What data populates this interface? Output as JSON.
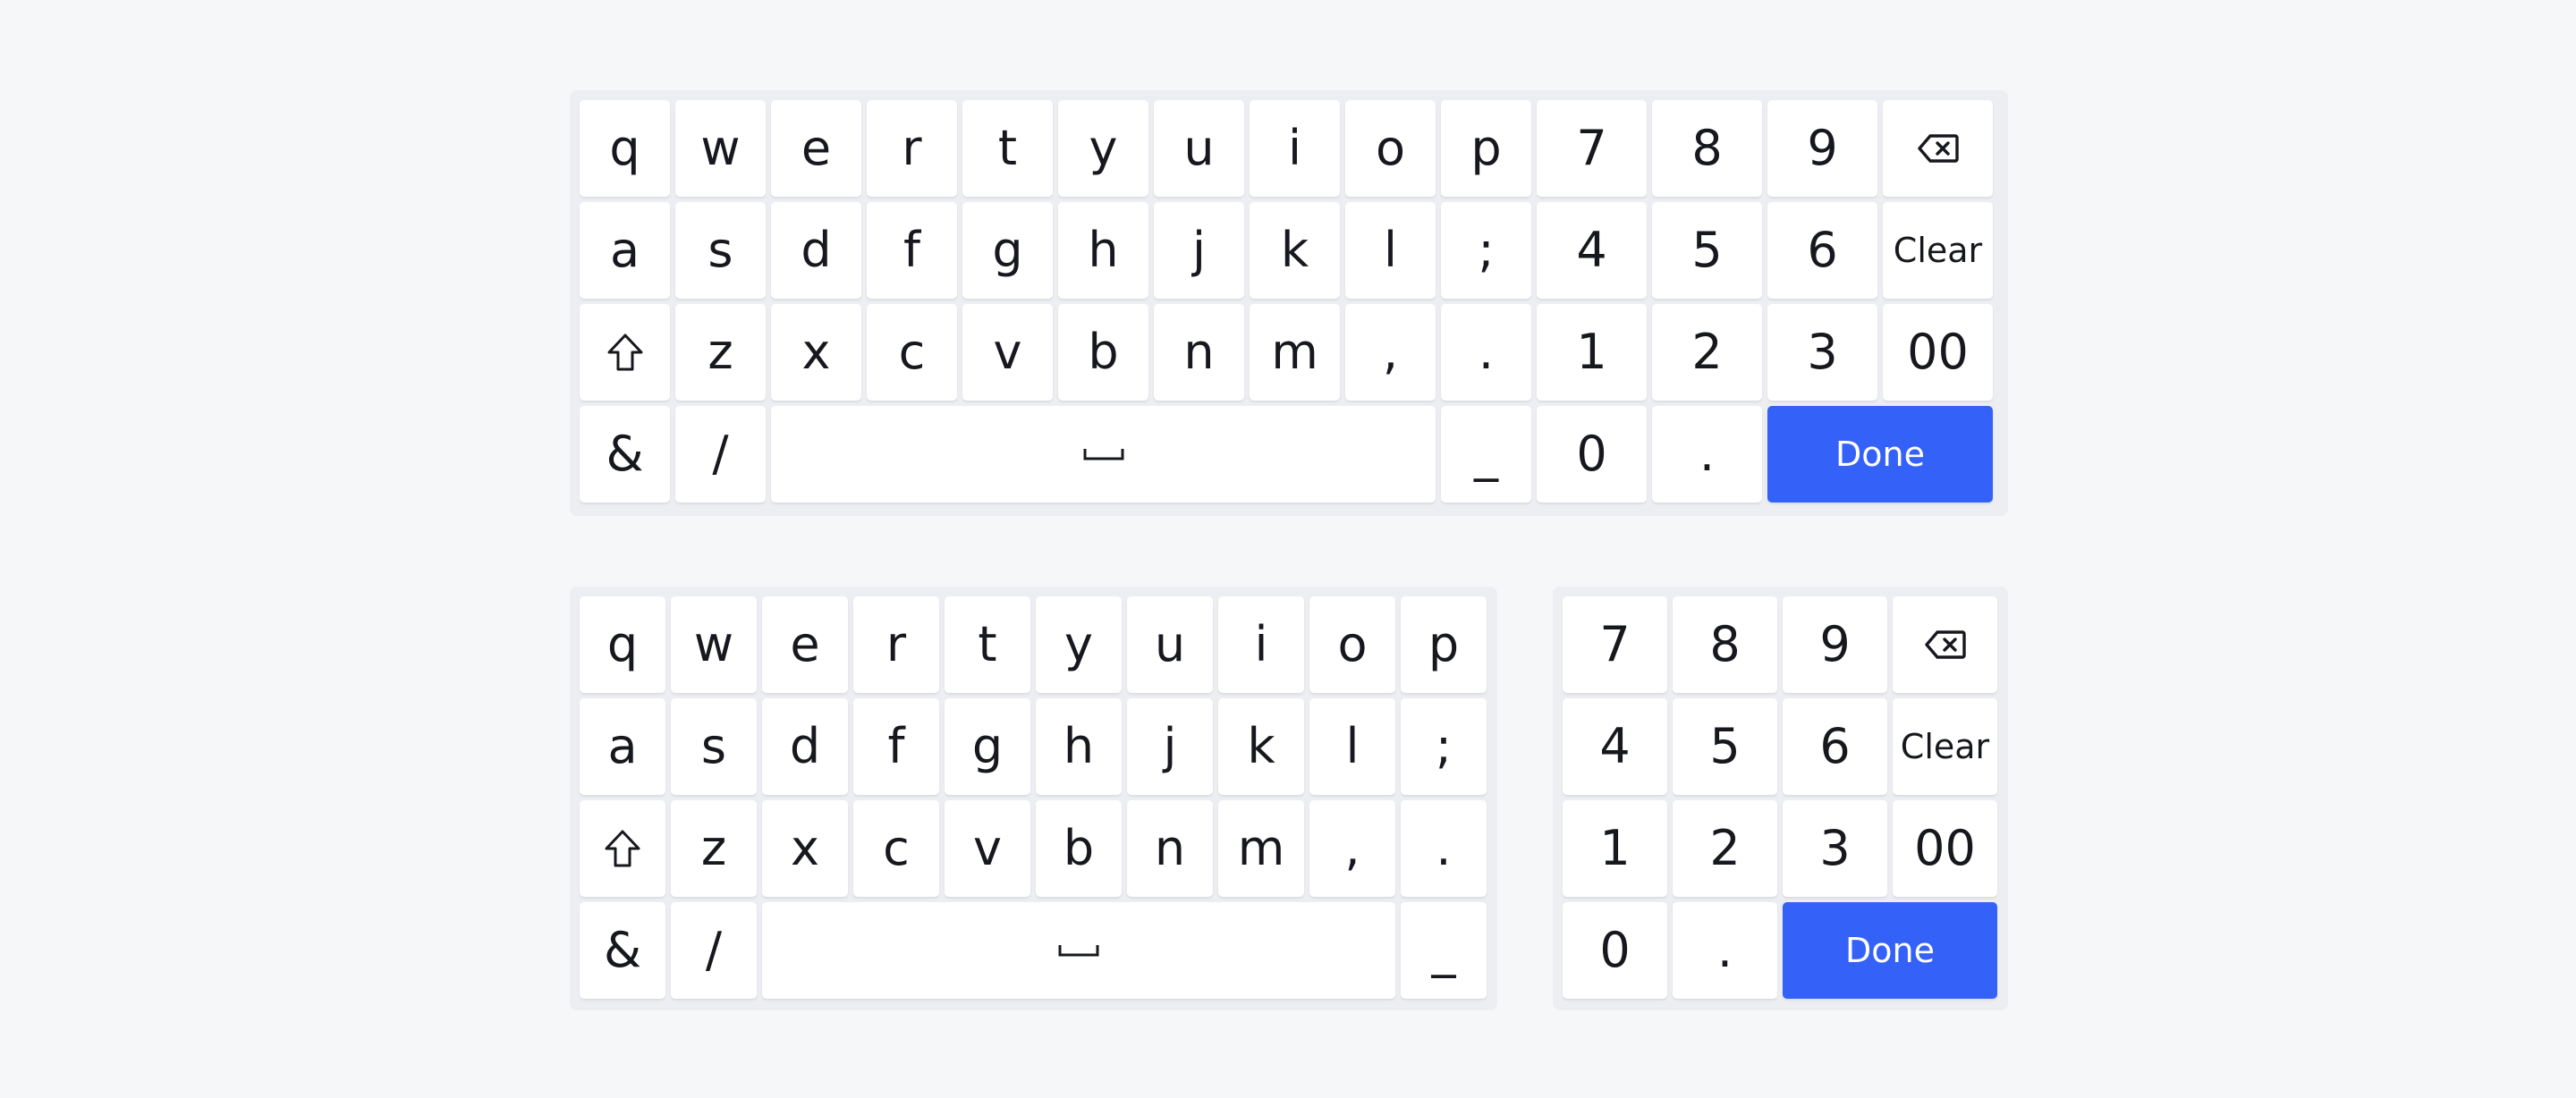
{
  "keyboards": {
    "full": {
      "rows": [
        [
          {
            "label": "q",
            "name": "key-q"
          },
          {
            "label": "w",
            "name": "key-w"
          },
          {
            "label": "e",
            "name": "key-e"
          },
          {
            "label": "r",
            "name": "key-r"
          },
          {
            "label": "t",
            "name": "key-t"
          },
          {
            "label": "y",
            "name": "key-y"
          },
          {
            "label": "u",
            "name": "key-u"
          },
          {
            "label": "i",
            "name": "key-i"
          },
          {
            "label": "o",
            "name": "key-o"
          },
          {
            "label": "p",
            "name": "key-p"
          },
          {
            "label": "7",
            "name": "key-7"
          },
          {
            "label": "8",
            "name": "key-8"
          },
          {
            "label": "9",
            "name": "key-9"
          },
          {
            "icon": "backspace-icon",
            "name": "backspace-key"
          }
        ],
        [
          {
            "label": "a",
            "name": "key-a"
          },
          {
            "label": "s",
            "name": "key-s"
          },
          {
            "label": "d",
            "name": "key-d"
          },
          {
            "label": "f",
            "name": "key-f"
          },
          {
            "label": "g",
            "name": "key-g"
          },
          {
            "label": "h",
            "name": "key-h"
          },
          {
            "label": "j",
            "name": "key-j"
          },
          {
            "label": "k",
            "name": "key-k"
          },
          {
            "label": "l",
            "name": "key-l"
          },
          {
            "label": ";",
            "name": "key-semicolon"
          },
          {
            "label": "4",
            "name": "key-4"
          },
          {
            "label": "5",
            "name": "key-5"
          },
          {
            "label": "6",
            "name": "key-6"
          },
          {
            "label": "Clear",
            "name": "clear-key",
            "style": "word"
          }
        ],
        [
          {
            "icon": "shift-icon",
            "name": "shift-key"
          },
          {
            "label": "z",
            "name": "key-z"
          },
          {
            "label": "x",
            "name": "key-x"
          },
          {
            "label": "c",
            "name": "key-c"
          },
          {
            "label": "v",
            "name": "key-v"
          },
          {
            "label": "b",
            "name": "key-b"
          },
          {
            "label": "n",
            "name": "key-n"
          },
          {
            "label": "m",
            "name": "key-m"
          },
          {
            "label": ",",
            "name": "key-comma"
          },
          {
            "label": ".",
            "name": "key-period"
          },
          {
            "label": "1",
            "name": "key-1"
          },
          {
            "label": "2",
            "name": "key-2"
          },
          {
            "label": "3",
            "name": "key-3"
          },
          {
            "label": "00",
            "name": "key-00"
          }
        ],
        [
          {
            "label": "&",
            "name": "key-ampersand"
          },
          {
            "label": "/",
            "name": "key-slash"
          },
          {
            "icon": "space-icon",
            "name": "space-key"
          },
          {
            "label": "_",
            "name": "key-underscore"
          },
          {
            "label": "0",
            "name": "key-0"
          },
          {
            "label": ".",
            "name": "key-decimal"
          },
          {
            "label": "Done",
            "name": "done-button",
            "style": "primary"
          }
        ]
      ]
    },
    "alpha": {
      "rows": [
        [
          {
            "label": "q",
            "name": "key-q"
          },
          {
            "label": "w",
            "name": "key-w"
          },
          {
            "label": "e",
            "name": "key-e"
          },
          {
            "label": "r",
            "name": "key-r"
          },
          {
            "label": "t",
            "name": "key-t"
          },
          {
            "label": "y",
            "name": "key-y"
          },
          {
            "label": "u",
            "name": "key-u"
          },
          {
            "label": "i",
            "name": "key-i"
          },
          {
            "label": "o",
            "name": "key-o"
          },
          {
            "label": "p",
            "name": "key-p"
          }
        ],
        [
          {
            "label": "a",
            "name": "key-a"
          },
          {
            "label": "s",
            "name": "key-s"
          },
          {
            "label": "d",
            "name": "key-d"
          },
          {
            "label": "f",
            "name": "key-f"
          },
          {
            "label": "g",
            "name": "key-g"
          },
          {
            "label": "h",
            "name": "key-h"
          },
          {
            "label": "j",
            "name": "key-j"
          },
          {
            "label": "k",
            "name": "key-k"
          },
          {
            "label": "l",
            "name": "key-l"
          },
          {
            "label": ";",
            "name": "key-semicolon"
          }
        ],
        [
          {
            "icon": "shift-icon",
            "name": "shift-key"
          },
          {
            "label": "z",
            "name": "key-z"
          },
          {
            "label": "x",
            "name": "key-x"
          },
          {
            "label": "c",
            "name": "key-c"
          },
          {
            "label": "v",
            "name": "key-v"
          },
          {
            "label": "b",
            "name": "key-b"
          },
          {
            "label": "n",
            "name": "key-n"
          },
          {
            "label": "m",
            "name": "key-m"
          },
          {
            "label": ",",
            "name": "key-comma"
          },
          {
            "label": ".",
            "name": "key-period"
          }
        ],
        [
          {
            "label": "&",
            "name": "key-ampersand"
          },
          {
            "label": "/",
            "name": "key-slash"
          },
          {
            "icon": "space-icon",
            "name": "space-key"
          },
          {
            "label": "_",
            "name": "key-underscore"
          }
        ]
      ]
    },
    "numpad": {
      "rows": [
        [
          {
            "label": "7",
            "name": "key-7"
          },
          {
            "label": "8",
            "name": "key-8"
          },
          {
            "label": "9",
            "name": "key-9"
          },
          {
            "icon": "backspace-icon",
            "name": "backspace-key"
          }
        ],
        [
          {
            "label": "4",
            "name": "key-4"
          },
          {
            "label": "5",
            "name": "key-5"
          },
          {
            "label": "6",
            "name": "key-6"
          },
          {
            "label": "Clear",
            "name": "clear-key",
            "style": "word"
          }
        ],
        [
          {
            "label": "1",
            "name": "key-1"
          },
          {
            "label": "2",
            "name": "key-2"
          },
          {
            "label": "3",
            "name": "key-3"
          },
          {
            "label": "00",
            "name": "key-00"
          }
        ],
        [
          {
            "label": "0",
            "name": "key-0"
          },
          {
            "label": ".",
            "name": "key-decimal"
          },
          {
            "label": "Done",
            "name": "done-button",
            "style": "primary"
          }
        ]
      ]
    }
  },
  "colors": {
    "background": "#f6f7f9",
    "panel": "#eceef2",
    "key": "#ffffff",
    "key_text": "#16181d",
    "accent": "#3461f7"
  }
}
